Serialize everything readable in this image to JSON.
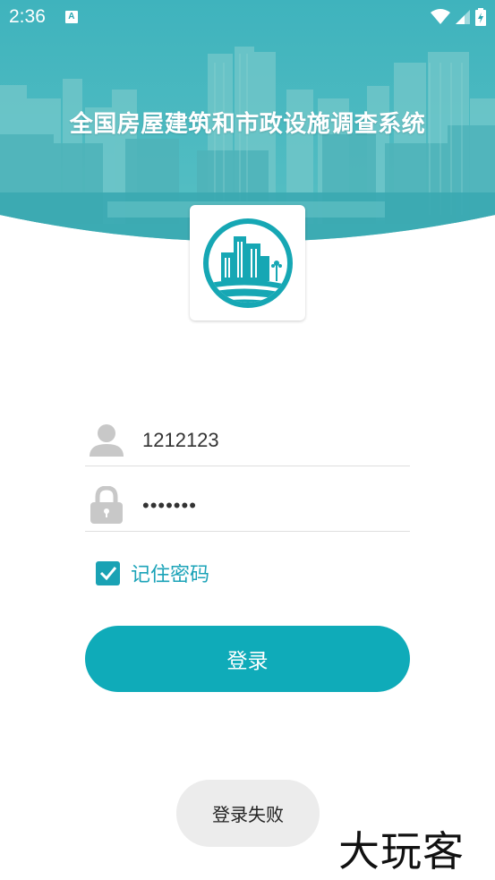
{
  "status_bar": {
    "time": "2:36",
    "notification_icon": "A"
  },
  "header": {
    "title": "全国房屋建筑和市政设施调查系统"
  },
  "login_form": {
    "username_value": "1212123",
    "password_value": "•••••••",
    "remember_label": "记住密码",
    "remember_checked": true,
    "login_button_label": "登录"
  },
  "toast": {
    "message": "登录失败"
  },
  "watermark": {
    "text": "大玩客"
  },
  "colors": {
    "accent": "#0fabb9",
    "remember_text": "#1ba3b8",
    "banner_overlay": "#2aa7b3"
  },
  "icons": {
    "username": "user-icon",
    "password": "lock-icon",
    "checkbox": "checkmark-icon",
    "status": [
      "wifi-icon",
      "signal-icon",
      "battery-charging-icon"
    ]
  }
}
